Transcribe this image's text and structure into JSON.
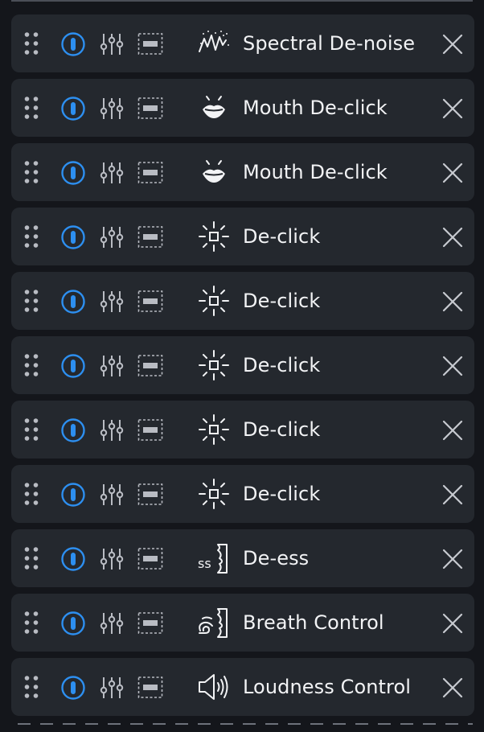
{
  "colors": {
    "background": "#14161b",
    "card": "#24282e",
    "accent": "#2d8ff0",
    "icon": "#b9bcc3",
    "text": "#f2f3f5"
  },
  "modules": [
    {
      "name": "Spectral De-noise",
      "icon": "spectral-denoise-icon",
      "enabled": true
    },
    {
      "name": "Mouth De-click",
      "icon": "mouth-icon",
      "enabled": true
    },
    {
      "name": "Mouth De-click",
      "icon": "mouth-icon",
      "enabled": true
    },
    {
      "name": "De-click",
      "icon": "declick-icon",
      "enabled": true
    },
    {
      "name": "De-click",
      "icon": "declick-icon",
      "enabled": true
    },
    {
      "name": "De-click",
      "icon": "declick-icon",
      "enabled": true
    },
    {
      "name": "De-click",
      "icon": "declick-icon",
      "enabled": true
    },
    {
      "name": "De-click",
      "icon": "declick-icon",
      "enabled": true
    },
    {
      "name": "De-ess",
      "icon": "deess-icon",
      "enabled": true
    },
    {
      "name": "Breath Control",
      "icon": "breath-icon",
      "enabled": true
    },
    {
      "name": "Loudness Control",
      "icon": "loudness-icon",
      "enabled": true
    }
  ]
}
